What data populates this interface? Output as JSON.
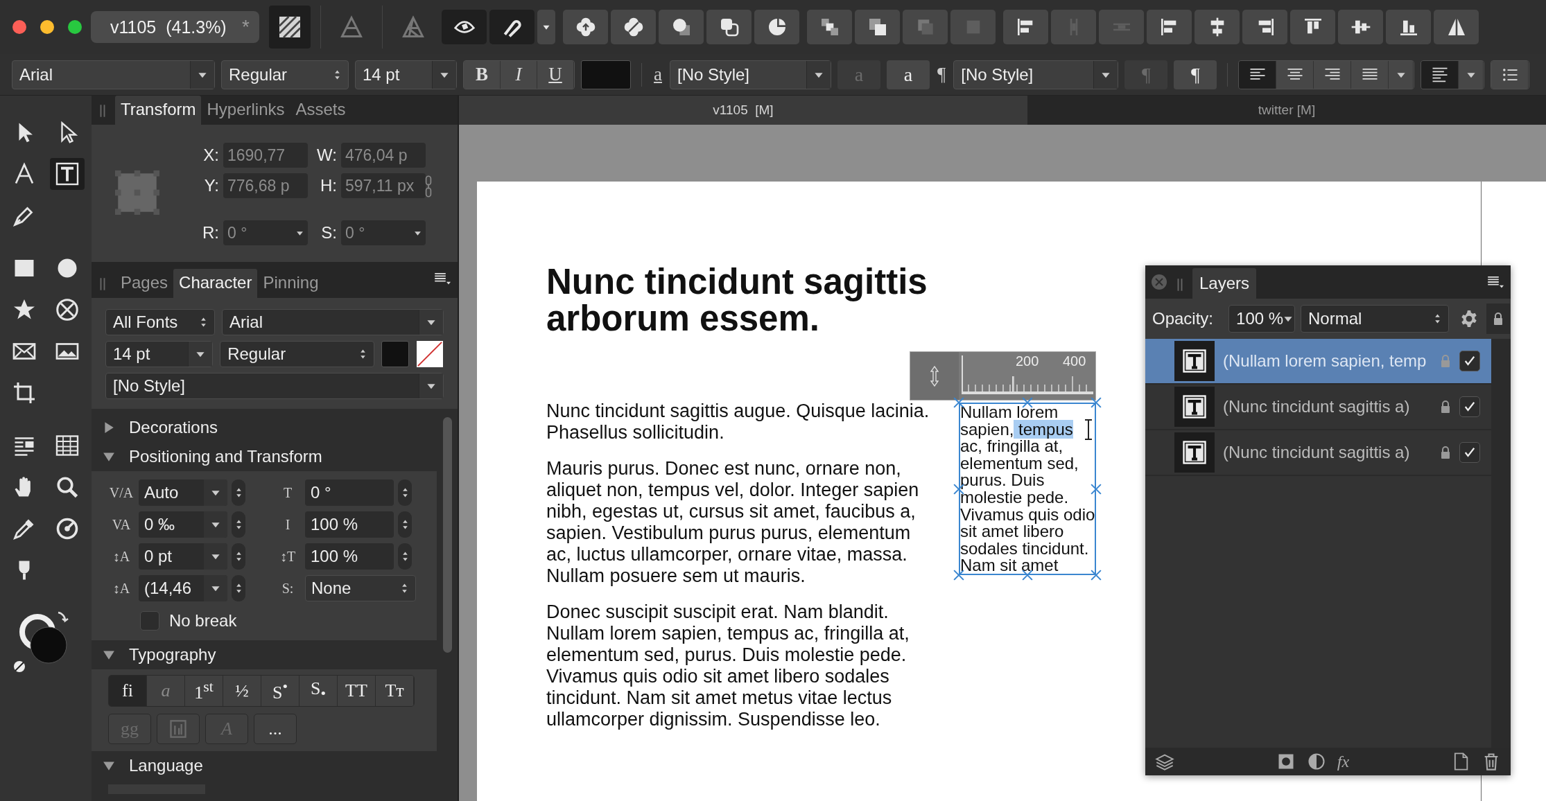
{
  "window": {
    "title": "v1105  (41.3%)",
    "modified_mark": "*"
  },
  "personas": [
    {
      "kind": "striped-square",
      "selected": true
    },
    {
      "kind": "triangle-outline",
      "selected": false
    },
    {
      "kind": "aperture",
      "selected": false
    }
  ],
  "toolbar_groups": [
    [
      {
        "kind": "eye",
        "on": true,
        "disabled": false
      },
      {
        "kind": "magnet",
        "on": true,
        "disabled": false
      },
      {
        "kind": "caret",
        "on": false,
        "disabled": false
      }
    ],
    [
      {
        "kind": "flower-up",
        "on": false,
        "disabled": false
      },
      {
        "kind": "flower",
        "on": false,
        "disabled": false
      },
      {
        "kind": "circle-square",
        "on": false,
        "disabled": false
      },
      {
        "kind": "square-squares",
        "on": false,
        "disabled": false
      },
      {
        "kind": "pie",
        "on": false,
        "disabled": false
      }
    ],
    [
      {
        "kind": "stack-a",
        "on": false,
        "disabled": false
      },
      {
        "kind": "stack-b",
        "on": false,
        "disabled": false
      },
      {
        "kind": "stack-c",
        "on": false,
        "disabled": true
      },
      {
        "kind": "stack-d",
        "on": false,
        "disabled": true
      }
    ],
    [
      {
        "kind": "align-options",
        "on": false,
        "disabled": false
      },
      {
        "kind": "distribute-v",
        "on": false,
        "disabled": true
      },
      {
        "kind": "distribute-h",
        "on": false,
        "disabled": true
      },
      {
        "kind": "align-left-bars",
        "on": false,
        "disabled": false
      },
      {
        "kind": "align-hcenter",
        "on": false,
        "disabled": false
      },
      {
        "kind": "align-right-bars",
        "on": false,
        "disabled": false
      },
      {
        "kind": "align-top",
        "on": false,
        "disabled": false
      },
      {
        "kind": "align-middle",
        "on": false,
        "disabled": false
      },
      {
        "kind": "align-bottom",
        "on": false,
        "disabled": false
      },
      {
        "kind": "flip",
        "on": false,
        "disabled": false
      }
    ]
  ],
  "format_bar": {
    "font": "Arial",
    "font_style": "Regular",
    "font_size": "14 pt",
    "style_buttons": [
      {
        "label": "B",
        "kind": "bold"
      },
      {
        "label": "I",
        "kind": "italic"
      },
      {
        "label": "U",
        "kind": "underline"
      }
    ],
    "char_style": {
      "label": "a",
      "value": "[No Style]",
      "buttons": [
        {
          "label": "a",
          "disabled": true
        },
        {
          "label": "a",
          "disabled": false
        }
      ]
    },
    "para_style": {
      "label": "¶",
      "value": "[No Style]",
      "buttons": [
        {
          "label": "¶",
          "disabled": true
        },
        {
          "label": "¶",
          "disabled": false
        }
      ]
    },
    "alignment_buttons": [
      {
        "kind": "text-left",
        "selected": true
      },
      {
        "kind": "text-center",
        "selected": false
      },
      {
        "kind": "text-right",
        "selected": false
      },
      {
        "kind": "text-justify",
        "selected": false
      }
    ],
    "extra_buttons": [
      {
        "kind": "text-ragged",
        "selected": true
      },
      {
        "kind": "list-bullets",
        "selected": false
      }
    ]
  },
  "tool_groups": [
    [
      [
        {
          "kind": "arrow",
          "selected": false
        },
        {
          "kind": "arrow-outline",
          "selected": false
        }
      ],
      [
        {
          "kind": "letter-a",
          "selected": false
        },
        {
          "kind": "frame-text",
          "selected": true
        }
      ],
      [
        {
          "kind": "pen",
          "selected": false
        }
      ]
    ],
    [
      [
        {
          "kind": "rect",
          "selected": false
        },
        {
          "kind": "ellipse",
          "selected": false
        }
      ],
      [
        {
          "kind": "star",
          "selected": false
        },
        {
          "kind": "x-circle",
          "selected": false
        }
      ],
      [
        {
          "kind": "envelope",
          "selected": false
        },
        {
          "kind": "landscape",
          "selected": false
        }
      ],
      [
        {
          "kind": "crop",
          "selected": false
        }
      ]
    ],
    [
      [
        {
          "kind": "text-wrap",
          "selected": false
        },
        {
          "kind": "table",
          "selected": false
        }
      ],
      [
        {
          "kind": "hand",
          "selected": false
        },
        {
          "kind": "zoom",
          "selected": false
        }
      ],
      [
        {
          "kind": "eyedropper",
          "selected": false
        },
        {
          "kind": "color-picker",
          "selected": false
        }
      ],
      [
        {
          "kind": "fill",
          "selected": false
        }
      ]
    ]
  ],
  "transform_panel": {
    "tabs": [
      {
        "label": "Transform",
        "selected": true
      },
      {
        "label": "Hyperlinks",
        "selected": false
      },
      {
        "label": "Assets",
        "selected": false
      }
    ],
    "fields": [
      {
        "label": "X:",
        "value": "1690,77"
      },
      {
        "label": "W:",
        "value": "476,04 p"
      },
      {
        "label": "Y:",
        "value": "776,68 p"
      },
      {
        "label": "H:",
        "value": "597,11 px"
      }
    ],
    "angle_fields": [
      {
        "label": "R:",
        "value": "0 °"
      },
      {
        "label": "S:",
        "value": "0 °"
      }
    ]
  },
  "character_panel": {
    "tabs": [
      {
        "label": "Pages",
        "selected": false
      },
      {
        "label": "Character",
        "selected": true
      },
      {
        "label": "Pinning",
        "selected": false
      }
    ],
    "font_collection": "All Fonts",
    "font": "Arial",
    "size": "14 pt",
    "style": "Regular",
    "paragraph_style": "[No Style]",
    "sections": [
      {
        "title": "Decorations",
        "kind": "decorations",
        "expanded": false
      },
      {
        "title": "Positioning and Transform",
        "kind": "positioning",
        "expanded": true,
        "fields": [
          {
            "icon": "V/A",
            "value": "Auto",
            "kind": "dropdown"
          },
          {
            "icon": "T",
            "value": "0 °",
            "kind": "stepper"
          },
          {
            "icon": "VA",
            "value": "0 ‰",
            "kind": "dropdown"
          },
          {
            "icon": "I",
            "value": "100 %",
            "kind": "stepper"
          },
          {
            "icon": "↕A",
            "value": "0 pt",
            "kind": "dropdown"
          },
          {
            "icon": "↕T",
            "value": "100 %",
            "kind": "stepper"
          },
          {
            "icon": "↕A",
            "value": "(14,46",
            "kind": "dropdown"
          },
          {
            "icon": "S:",
            "value": "None",
            "kind": "select"
          }
        ],
        "no_break": {
          "label": "No break",
          "checked": false
        }
      },
      {
        "title": "Typography",
        "kind": "typography",
        "expanded": true,
        "ligature_buttons": [
          {
            "label": "fi",
            "kind": "ligature",
            "selected": true,
            "disabled": false
          },
          {
            "label": "a",
            "kind": "swash",
            "selected": false,
            "disabled": false
          },
          {
            "label": "1$^{st}$",
            "kind": "ordinal",
            "selected": false,
            "disabled": false
          },
          {
            "label": "½",
            "kind": "fraction",
            "selected": false,
            "disabled": false
          },
          {
            "label": "S$^{•}$",
            "kind": "superscript",
            "selected": false,
            "disabled": false
          },
          {
            "label": "S$_{•}$",
            "kind": "subscript",
            "selected": false,
            "disabled": false
          },
          {
            "label": "TT",
            "kind": "caps",
            "selected": false,
            "disabled": false
          },
          {
            "label": "Tᴛ",
            "kind": "small-caps",
            "selected": false,
            "disabled": false
          }
        ],
        "option_buttons": [
          {
            "label": "gg",
            "kind": "text",
            "selected": false,
            "disabled": true
          },
          {
            "kind": "boxed",
            "selected": false,
            "disabled": true
          },
          {
            "label": "A",
            "kind": "swash",
            "selected": false,
            "disabled": true
          },
          {
            "label": "...",
            "kind": "text",
            "selected": false,
            "disabled": false
          }
        ]
      },
      {
        "title": "Language",
        "kind": "language",
        "expanded": true
      }
    ]
  },
  "document_tabs": [
    {
      "label": "v1105  [M]",
      "selected": true
    },
    {
      "label": "twitter [M]",
      "selected": false
    }
  ],
  "page": {
    "heading": "Nunc tincidunt sagittis arborum essem.",
    "paragraphs": [
      "Nunc tincidunt sagittis augue. Quisque lacinia. Phasellus sollicitudin.",
      "Mauris purus. Donec est nunc, ornare non, aliquet non, tempus vel, dolor. Integer sapien nibh, egestas ut, cursus sit amet, faucibus a, sapien. Vestibulum purus purus, elementum ac, luctus ullamcorper, ornare vitae, massa. Nullam posuere sem ut mauris.",
      "Donec suscipit suscipit erat. Nam blandit. Nullam lorem sapien, tempus ac, fringilla at, elementum sed, purus. Duis molestie pede. Vivamus quis odio sit amet libero sodales tincidunt. Nam sit amet metus vitae lectus ullamcorper dignissim. Suspendisse leo."
    ],
    "text_frame": {
      "before": "Nullam lorem sapien,",
      "selected": " tempus ",
      "after": "ac, fringilla at, elementum sed, purus. Duis molestie pede. Vivamus quis odio sit amet libero sodales tincidunt. Nam sit amet"
    },
    "ruler_labels": [
      "200",
      "400"
    ]
  },
  "layers_panel": {
    "title": "Layers",
    "opacity_label": "Opacity:",
    "opacity": "100 %",
    "blend_mode": "Normal",
    "layers": [
      {
        "name": "(Nullam lorem sapien, temp",
        "selected": true,
        "visible": true
      },
      {
        "name": "(Nunc tincidunt sagittis a)",
        "selected": false,
        "visible": true
      },
      {
        "name": "(Nunc tincidunt sagittis a)",
        "selected": false,
        "visible": true
      }
    ],
    "footer_left": [
      {
        "kind": "layers"
      }
    ],
    "footer_center": [
      {
        "kind": "mask"
      },
      {
        "kind": "adjust"
      },
      {
        "kind": "fx",
        "label": "fx"
      }
    ],
    "footer_right": [
      {
        "kind": "page"
      },
      {
        "kind": "trash"
      }
    ]
  }
}
